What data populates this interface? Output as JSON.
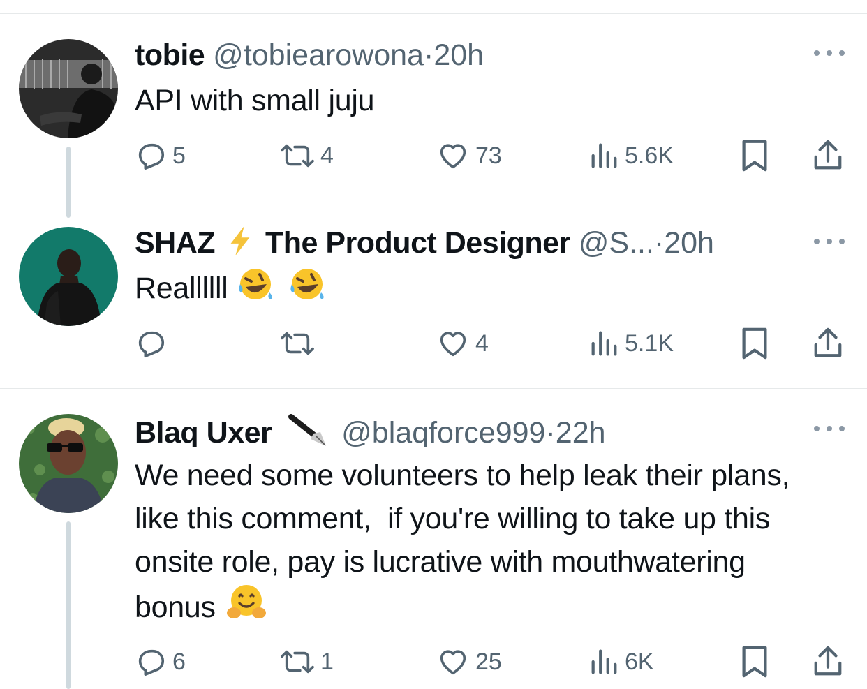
{
  "tweets": [
    {
      "name": "tobie",
      "handle": "@tobiearowona",
      "separator": "·",
      "time": "20h",
      "text": "API with small juju",
      "counts": {
        "replies": "5",
        "reposts": "4",
        "likes": "73",
        "views": "5.6K"
      }
    },
    {
      "name": "SHAZ",
      "name_rest": "The Product Designer",
      "handle": "@S...",
      "separator": "·",
      "time": "20h",
      "text": "Reallllll",
      "counts": {
        "replies": "",
        "reposts": "",
        "likes": "4",
        "views": "5.1K"
      }
    },
    {
      "name": "Blaq Uxer",
      "handle": "@blaqforce999",
      "separator": "·",
      "time": "22h",
      "text": "We need some volunteers to help leak their plans, like this comment,  if you're willing to take up this onsite role, pay is lucrative with mouthwatering bonus",
      "counts": {
        "replies": "6",
        "reposts": "1",
        "likes": "25",
        "views": "6K"
      }
    }
  ],
  "colors": {
    "text": "#0f1419",
    "secondary": "#536471",
    "thread_line": "#cfd9de",
    "divider": "#e6e9ea",
    "lightning": "#f5c33b",
    "avatar2_bg": "#127a6a"
  },
  "icons": [
    "reply-icon",
    "repost-icon",
    "like-icon",
    "views-icon",
    "bookmark-icon",
    "share-icon",
    "more-icon",
    "lightning-emoji",
    "fountain-pen-emoji",
    "rofl-emoji",
    "hugging-emoji"
  ]
}
